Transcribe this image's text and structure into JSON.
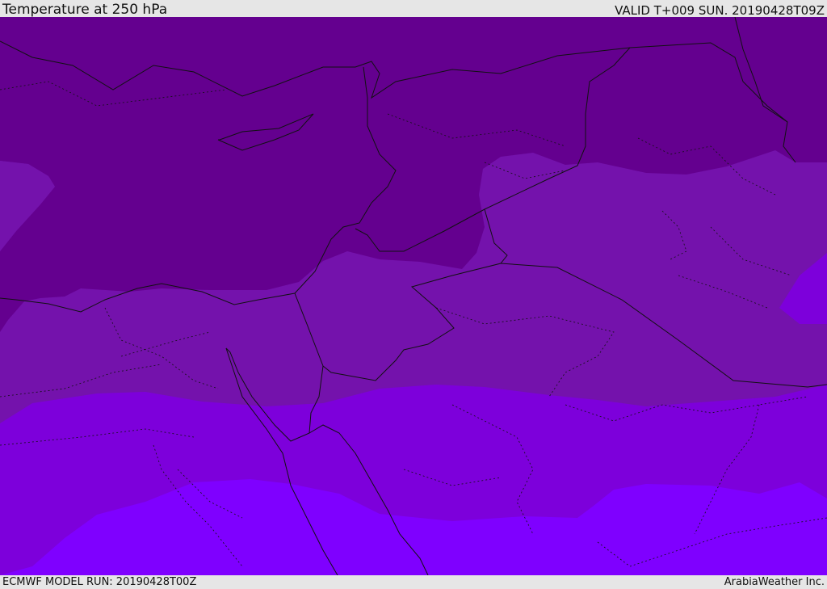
{
  "header": {
    "title": "Temperature at 250 hPa",
    "valid": "VALID T+009 SUN. 20190428T09Z"
  },
  "footer": {
    "model_run": "ECMWF MODEL RUN: 20190428T00Z",
    "credit": "ArabiaWeather Inc."
  },
  "map": {
    "colors": {
      "coldest": "#64008f",
      "cold": "#7412ac",
      "mid": "#7d00db",
      "warm": "#7f00ff",
      "borders": "#111111"
    }
  }
}
